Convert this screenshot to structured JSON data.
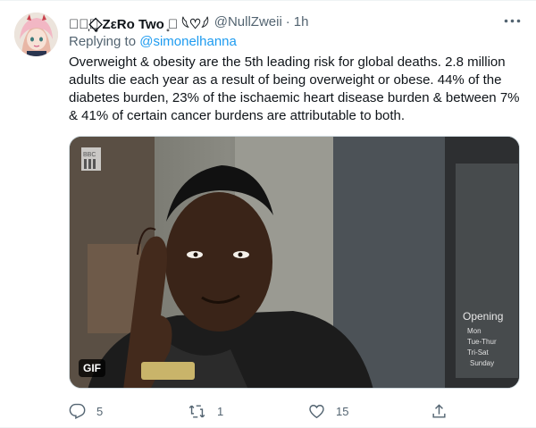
{
  "tweet": {
    "display_name": "⸙͎۪۫ ̥⃟ZεRo Two ̥⃟ 𓆩♡𓆪",
    "handle": "@NullZweii",
    "separator": "·",
    "time": "1h",
    "replying_prefix": "Replying to ",
    "replying_to": "@simonelhanna",
    "text": "Overweight & obesity are the 5th leading risk for global deaths. 2.8 million adults die each year as a result of being overweight or obese. 44% of the diabetes burden, 23% of the ischaemic heart disease burden & between 7% & 41% of certain cancer burdens are attributable to both.",
    "media": {
      "badge": "GIF",
      "sign_text": "Opening",
      "sign_lines": [
        "Mon",
        "Tue-Thur",
        "Tri-Sat",
        "Sunday"
      ],
      "icon": "bbc-three-logo"
    },
    "actions": {
      "reply_count": "5",
      "retweet_count": "1",
      "like_count": "15"
    }
  },
  "colors": {
    "accent": "#1d9bf0",
    "secondary_text": "#536471",
    "primary_text": "#0f1419"
  }
}
